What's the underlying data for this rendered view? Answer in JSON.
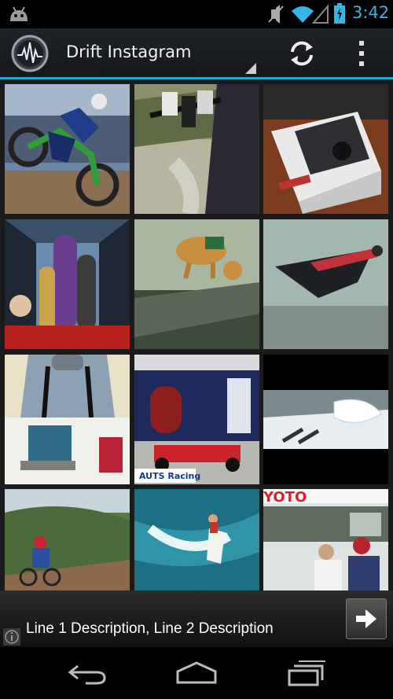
{
  "status_bar": {
    "time": "3:42",
    "icons": [
      "android-debug-icon",
      "mute-icon",
      "wifi-icon",
      "signal-icon",
      "battery-icon"
    ],
    "accent_color": "#33b5e5"
  },
  "action_bar": {
    "title": "Drift Instagram",
    "logo_icon": "waveform-logo-icon",
    "actions": [
      "refresh-icon",
      "overflow-menu-icon"
    ],
    "divider_color": "#2aa6c9"
  },
  "photo_grid": {
    "columns": 3,
    "photos": [
      {
        "subject": "motocross rider jump"
      },
      {
        "subject": "mountain bike handlebars downhill"
      },
      {
        "subject": "action camera in box"
      },
      {
        "subject": "snowboards in gondola"
      },
      {
        "subject": "dog with camera harness"
      },
      {
        "subject": "wingsuit flyer"
      },
      {
        "subject": "person wearing chest harness at laptop"
      },
      {
        "subject": "go-kart racing setup",
        "overlay_text": "AUTS Racing"
      },
      {
        "subject": "skier in powder snow"
      },
      {
        "subject": "mountain biker on trail"
      },
      {
        "subject": "surfer on wave aerial"
      },
      {
        "subject": "motor event crowd"
      }
    ]
  },
  "ad_banner": {
    "text": "Line 1 Description, Line 2 Description",
    "arrow_icon": "arrow-right-icon",
    "info_icon": "info-icon"
  },
  "nav_bar": {
    "icons": [
      "back-icon",
      "home-icon",
      "recents-icon"
    ]
  }
}
